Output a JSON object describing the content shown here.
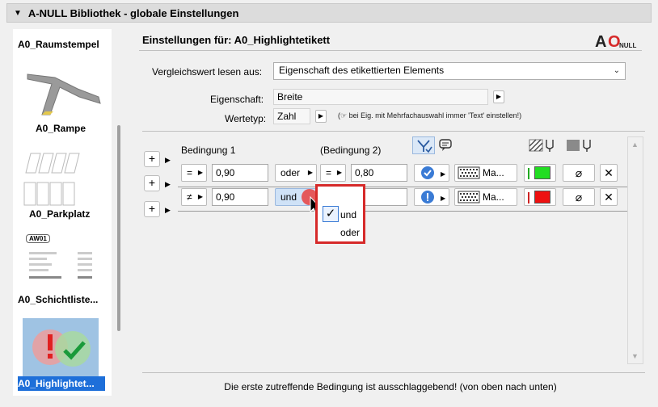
{
  "window": {
    "title": "A-NULL Bibliothek - globale Einstellungen"
  },
  "sidebar": {
    "items": [
      {
        "label": "A0_Raumstempel"
      },
      {
        "label": "A0_Rampe"
      },
      {
        "label": "A0_Parkplatz"
      },
      {
        "label": "A0_Schichtliste...",
        "preview_tag": "AW01"
      },
      {
        "label": "A0_Highlightet...",
        "selected": true
      }
    ]
  },
  "main": {
    "section_title": "Einstellungen für: A0_Highlightetikett",
    "logo": {
      "a": "A",
      "o": "O",
      "sub": "NULL"
    },
    "compare": {
      "label": "Vergleichswert lesen aus:",
      "value": "Eigenschaft des etikettierten Elements"
    },
    "property": {
      "label": "Eigenschaft:",
      "value": "Breite"
    },
    "valuetype": {
      "label": "Wertetyp:",
      "value": "Zahl",
      "hint": "(☞ bei Eig. mit Mehrfachauswahl immer 'Text' einstellen!)"
    },
    "conditions": {
      "header1": "Bedingung 1",
      "header2": "(Bedingung 2)",
      "rows": [
        {
          "op1": "=",
          "val1": "0,90",
          "logic": "oder",
          "op2": "=",
          "val2": "0,80",
          "status": "check",
          "pattern": "Ma...",
          "color": "#22dd22"
        },
        {
          "op1": "≠",
          "val1": "0,90",
          "logic": "und",
          "op2": "",
          "val2": "80",
          "status": "warning",
          "pattern": "Ma...",
          "color": "#ee1111"
        }
      ]
    },
    "logic_menu": {
      "options": [
        "und",
        "oder"
      ],
      "selected": "und"
    },
    "footer": "Die erste zutreffende Bedingung ist ausschlaggebend! (von oben nach unten)"
  },
  "colors": {
    "accent_red": "#d62a2a",
    "green": "#22dd22",
    "red": "#ee1111",
    "selected_bg": "#1e6fd9"
  }
}
